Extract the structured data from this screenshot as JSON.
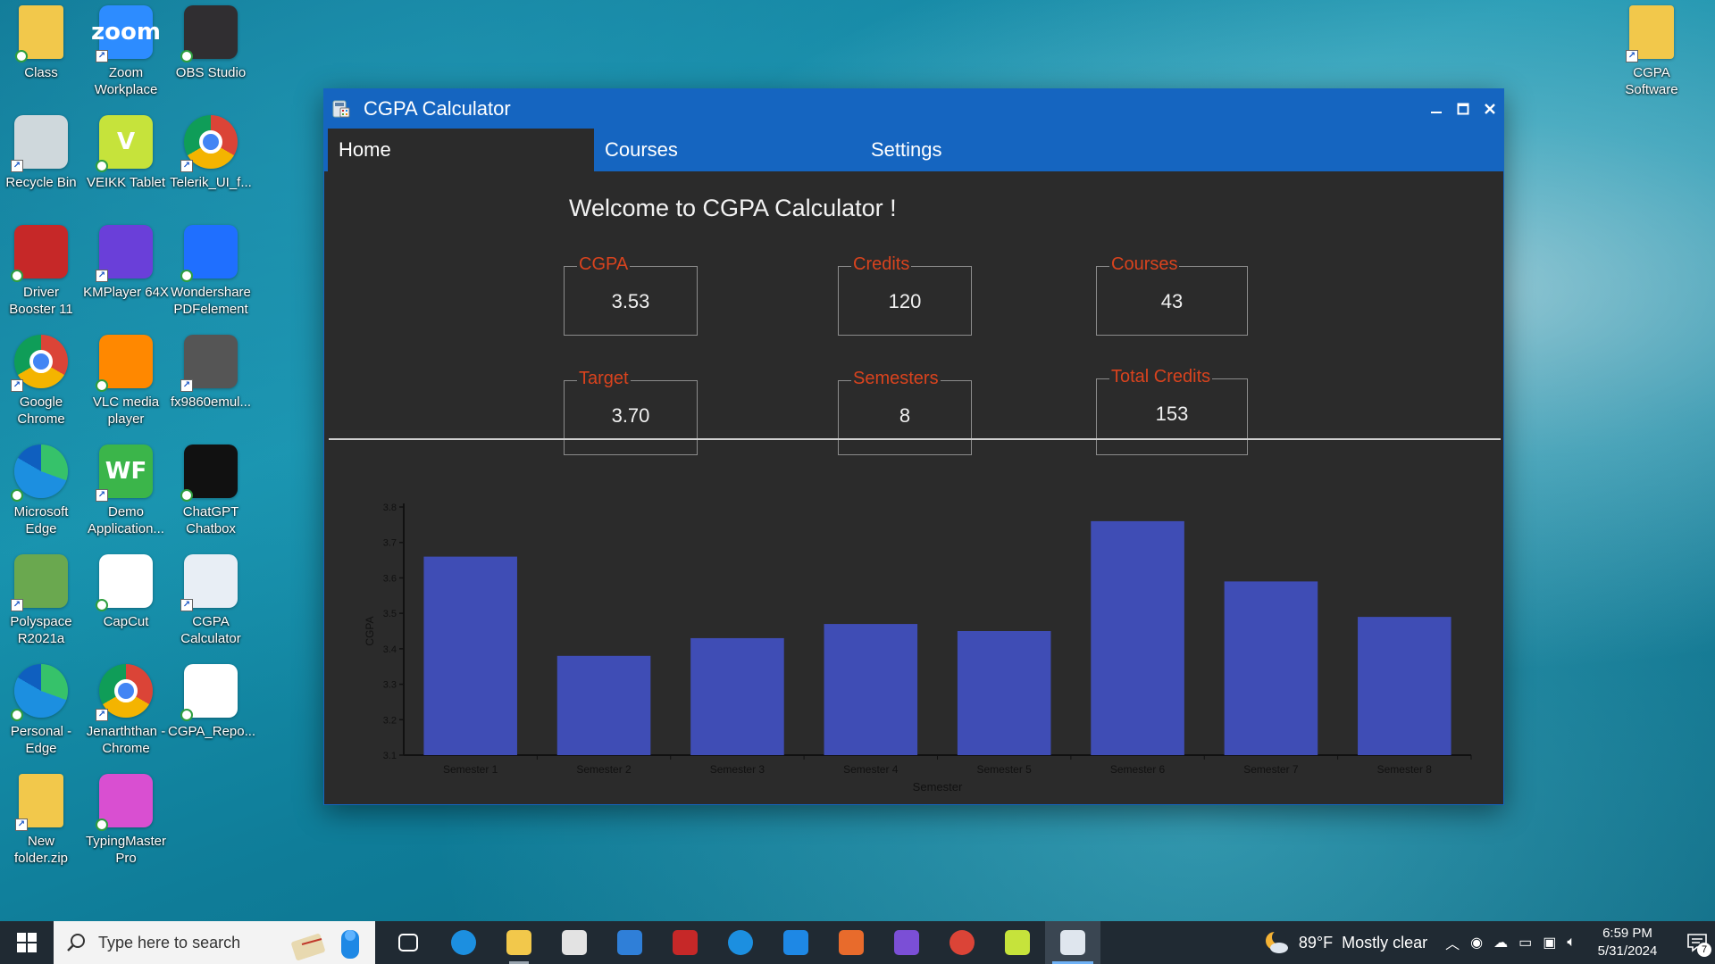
{
  "desktop": {
    "icons": [
      {
        "label": "Class",
        "icon": "folder-icon",
        "color": "#f2c84b"
      },
      {
        "label": "Zoom\nWorkplace",
        "icon": "zoom-icon",
        "color": "#2d8cff",
        "glyph": "zoom"
      },
      {
        "label": "OBS Studio",
        "icon": "obs-icon",
        "color": "#302e31"
      },
      {
        "label": "Recycle Bin",
        "icon": "recycle-bin-icon",
        "color": "#cfd8dc"
      },
      {
        "label": "VEIKK Tablet",
        "icon": "veikk-icon",
        "color": "#c6e33b",
        "glyph": "V"
      },
      {
        "label": "Telerik_UI_f...",
        "icon": "chrome-icon",
        "color": "#ffffff"
      },
      {
        "label": "Driver\nBooster 11",
        "icon": "driver-booster-icon",
        "color": "#c62828"
      },
      {
        "label": "KMPlayer 64X",
        "icon": "kmplayer-icon",
        "color": "#6a3fd9"
      },
      {
        "label": "Wondershare\nPDFelement",
        "icon": "pdfelement-icon",
        "color": "#1f6fff"
      },
      {
        "label": "Google\nChrome",
        "icon": "chrome-icon",
        "color": "#ffffff"
      },
      {
        "label": "VLC media\nplayer",
        "icon": "vlc-icon",
        "color": "#ff8800"
      },
      {
        "label": "fx9860emul...",
        "icon": "calculator-icon",
        "color": "#555555"
      },
      {
        "label": "Microsoft\nEdge",
        "icon": "edge-icon",
        "color": "#1fa7d9"
      },
      {
        "label": "Demo\nApplication...",
        "icon": "wf-icon",
        "color": "#3bb54a",
        "glyph": "WF"
      },
      {
        "label": "ChatGPT\nChatbox",
        "icon": "chatgpt-icon",
        "color": "#111111"
      },
      {
        "label": "Polyspace\nR2021a",
        "icon": "polyspace-icon",
        "color": "#6aa84f"
      },
      {
        "label": "CapCut",
        "icon": "capcut-icon",
        "color": "#ffffff"
      },
      {
        "label": "CGPA\nCalculator",
        "icon": "cgpa-calculator-icon",
        "color": "#e8eef5"
      },
      {
        "label": "Personal -\nEdge",
        "icon": "edge-icon",
        "color": "#1fa7d9"
      },
      {
        "label": "Jenarththan -\nChrome",
        "icon": "chrome-icon",
        "color": "#ffffff"
      },
      {
        "label": "CGPA_Repo...",
        "icon": "document-icon",
        "color": "#ffffff"
      },
      {
        "label": "New\nfolder.zip",
        "icon": "zip-folder-icon",
        "color": "#f2c84b"
      },
      {
        "label": "TypingMaster\nPro",
        "icon": "typingmaster-icon",
        "color": "#d94fd1"
      },
      {
        "label": "CGPA\nSoftware",
        "icon": "folder-icon",
        "color": "#f2c84b"
      }
    ]
  },
  "window": {
    "title": "CGPA Calculator",
    "tabs": [
      {
        "label": "Home",
        "active": true
      },
      {
        "label": "Courses",
        "active": false
      },
      {
        "label": "Settings",
        "active": false
      }
    ],
    "welcome": "Welcome to CGPA Calculator !",
    "stats": [
      {
        "label": "CGPA",
        "value": "3.53"
      },
      {
        "label": "Credits",
        "value": "120"
      },
      {
        "label": "Courses",
        "value": "43"
      },
      {
        "label": "Target",
        "value": "3.70"
      },
      {
        "label": "Semesters",
        "value": "8"
      },
      {
        "label": "Total Credits",
        "value": "153"
      }
    ],
    "colors": {
      "accent": "#1565c0",
      "label": "#d9431e",
      "background": "#2b2b2b",
      "bar": "#3f4db5"
    }
  },
  "chart_data": {
    "type": "bar",
    "categories": [
      "Semester 1",
      "Semester 2",
      "Semester 3",
      "Semester 4",
      "Semester 5",
      "Semester 6",
      "Semester 7",
      "Semester 8"
    ],
    "values": [
      3.66,
      3.38,
      3.43,
      3.47,
      3.45,
      3.76,
      3.59,
      3.49
    ],
    "xlabel": "Semester",
    "ylabel": "CGPA",
    "ylim": [
      3.1,
      3.8
    ],
    "yticks": [
      "3.1",
      "3.2",
      "3.3",
      "3.4",
      "3.5",
      "3.6",
      "3.7",
      "3.8"
    ],
    "grid": false,
    "color": "#3f4db5"
  },
  "taskbar": {
    "search_placeholder": "Type here to search",
    "apps": [
      "task-view-icon",
      "edge-icon",
      "file-explorer-icon",
      "store-icon",
      "mail-icon",
      "driver-booster-icon",
      "edge-icon",
      "vscode-icon",
      "matlab-icon",
      "visual-studio-icon",
      "chrome-icon",
      "snipping-tool-icon",
      "cgpa-calculator-icon"
    ],
    "weather": "89°F  Mostly clear",
    "time": "6:59 PM",
    "date": "5/31/2024",
    "notifications": "7"
  }
}
